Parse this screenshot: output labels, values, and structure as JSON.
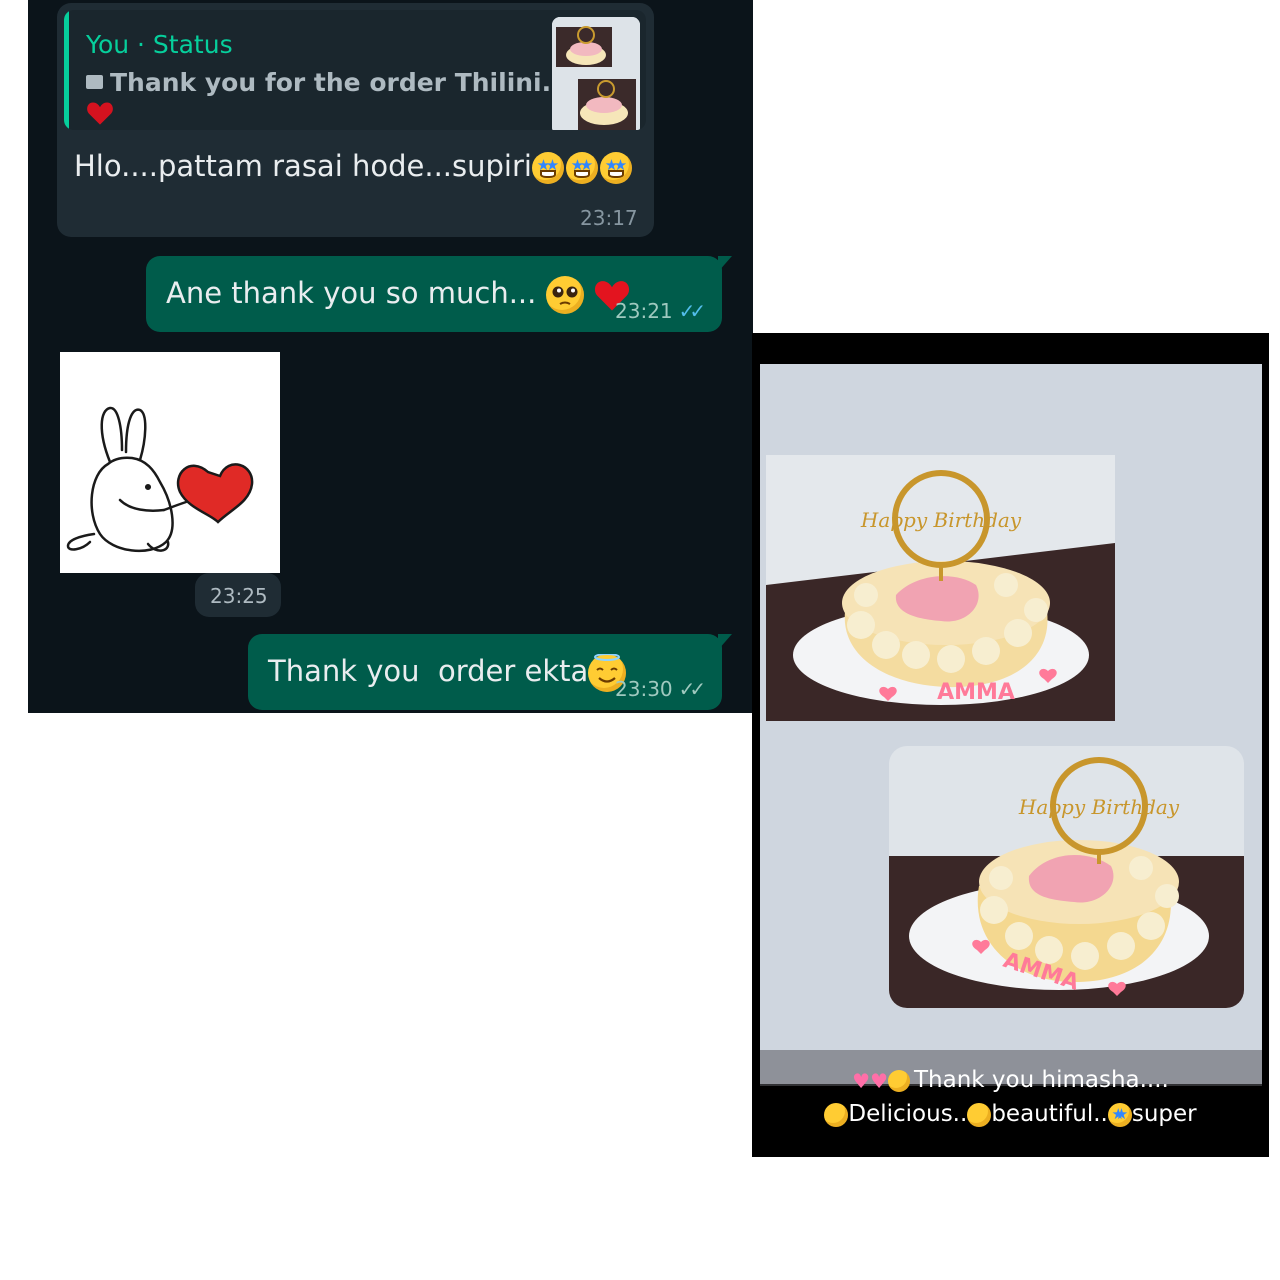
{
  "chat": {
    "reply_quote": {
      "author": "You · Status",
      "text": "Thank you for the order Thilini..."
    },
    "messages": [
      {
        "text": "Hlo....pattam rasai hode...supiri",
        "time": "23:17"
      },
      {
        "text": "Ane thank you so much...",
        "time": "23:21"
      },
      {
        "time": "23:25"
      },
      {
        "text": "Thank you  order ekta",
        "time": "23:30"
      }
    ]
  },
  "status": {
    "caption_line1": "Thank you himasha....",
    "caption_line2_a": "Delicious..",
    "caption_line2_b": "beautiful..",
    "caption_line2_c": "super",
    "topper_text": "Happy Birthday",
    "cake_name": "AMMA"
  },
  "colors": {
    "chat_bg": "#0b141a",
    "incoming_bubble": "#1f2c34",
    "outgoing_bubble": "#005c4b",
    "accent": "#06cf9c",
    "read_ticks": "#53bdeb"
  },
  "icons": [
    "image-icon",
    "heart-icon",
    "double-check-icon",
    "bunny-sticker",
    "star-struck-emoji",
    "pleading-face-emoji",
    "smiling-halo-emoji"
  ]
}
